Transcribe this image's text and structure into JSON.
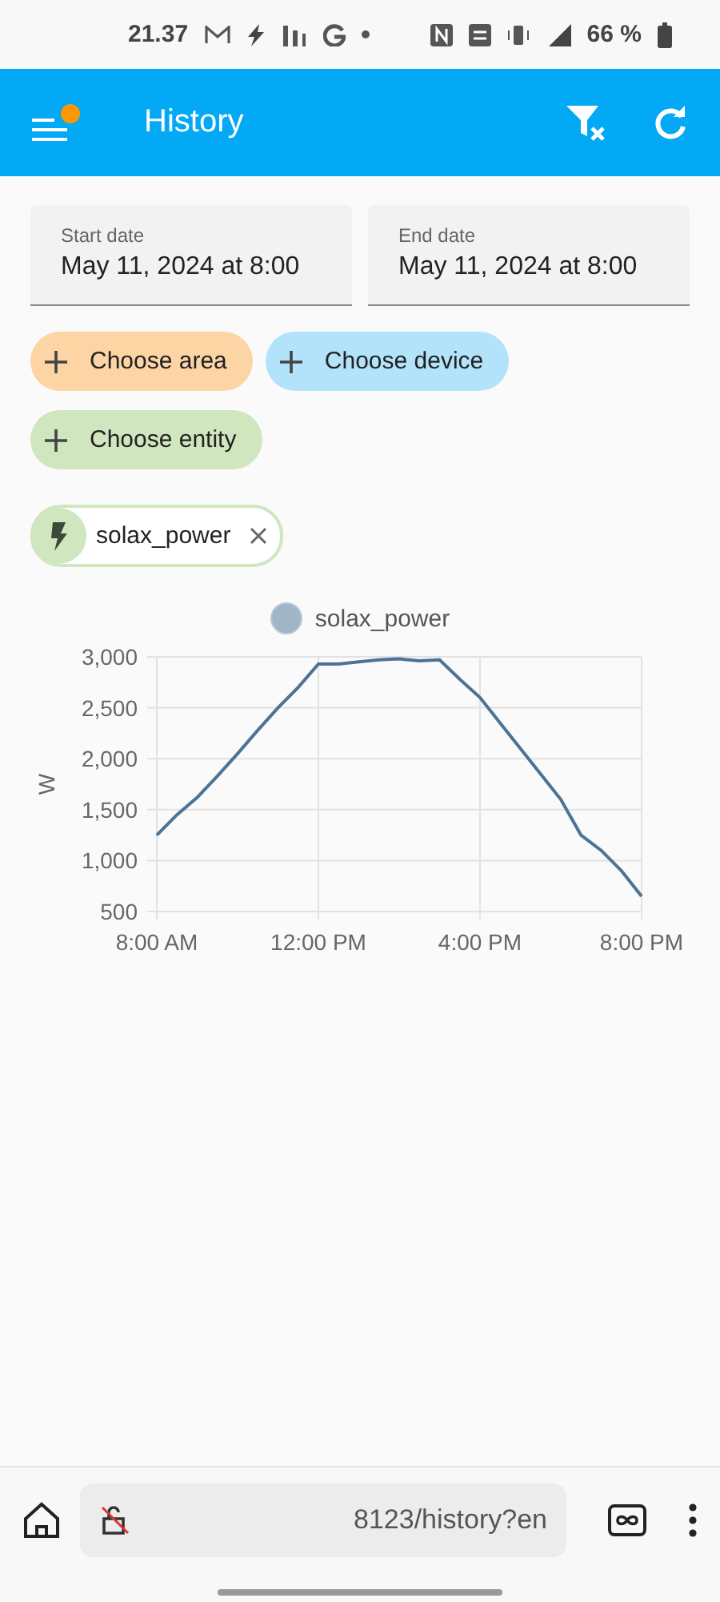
{
  "status_bar": {
    "time": "21.37",
    "battery": "66 %"
  },
  "app_bar": {
    "title": "History",
    "notification_dot": true
  },
  "date_fields": [
    {
      "label": "Start date",
      "value": "May 11, 2024 at 8:00"
    },
    {
      "label": "End date",
      "value": "May 11, 2024 at 8:00"
    }
  ],
  "target_chips": [
    {
      "label": "Choose area",
      "color": "#fdd5a4"
    },
    {
      "label": "Choose device",
      "color": "#b3e3fa"
    },
    {
      "label": "Choose entity",
      "color": "#cfe6bf"
    }
  ],
  "selected_entities": [
    {
      "label": "solax_power"
    }
  ],
  "chart": {
    "chart_data": {
      "type": "line",
      "grid": true,
      "ylabel": "W",
      "x": [
        8,
        8.5,
        9,
        9.5,
        10,
        10.5,
        11,
        11.5,
        12,
        12.5,
        13,
        13.5,
        14,
        14.5,
        15,
        15.5,
        16,
        16.5,
        17,
        17.5,
        18,
        18.5,
        19,
        19.5,
        20
      ],
      "xlim": [
        8,
        20
      ],
      "ylim": [
        500,
        3000
      ],
      "xticks": [
        {
          "value": 8,
          "label": "8:00 AM"
        },
        {
          "value": 12,
          "label": "12:00 PM"
        },
        {
          "value": 16,
          "label": "4:00 PM"
        },
        {
          "value": 20,
          "label": "8:00 PM"
        }
      ],
      "yticks": [
        {
          "value": 500,
          "label": "500"
        },
        {
          "value": 1000,
          "label": "1,000"
        },
        {
          "value": 1500,
          "label": "1,500"
        },
        {
          "value": 2000,
          "label": "2,000"
        },
        {
          "value": 2500,
          "label": "2,500"
        },
        {
          "value": 3000,
          "label": "3,000"
        }
      ],
      "series": [
        {
          "name": "solax_power",
          "color": "#4a7397",
          "values": [
            1250,
            1450,
            1620,
            1830,
            2050,
            2280,
            2500,
            2700,
            2930,
            2930,
            2950,
            2970,
            2980,
            2960,
            2970,
            2780,
            2600,
            2350,
            2100,
            1850,
            1600,
            1250,
            1100,
            900,
            650
          ]
        }
      ]
    }
  },
  "browser_bar": {
    "url": "8123/history?en"
  }
}
